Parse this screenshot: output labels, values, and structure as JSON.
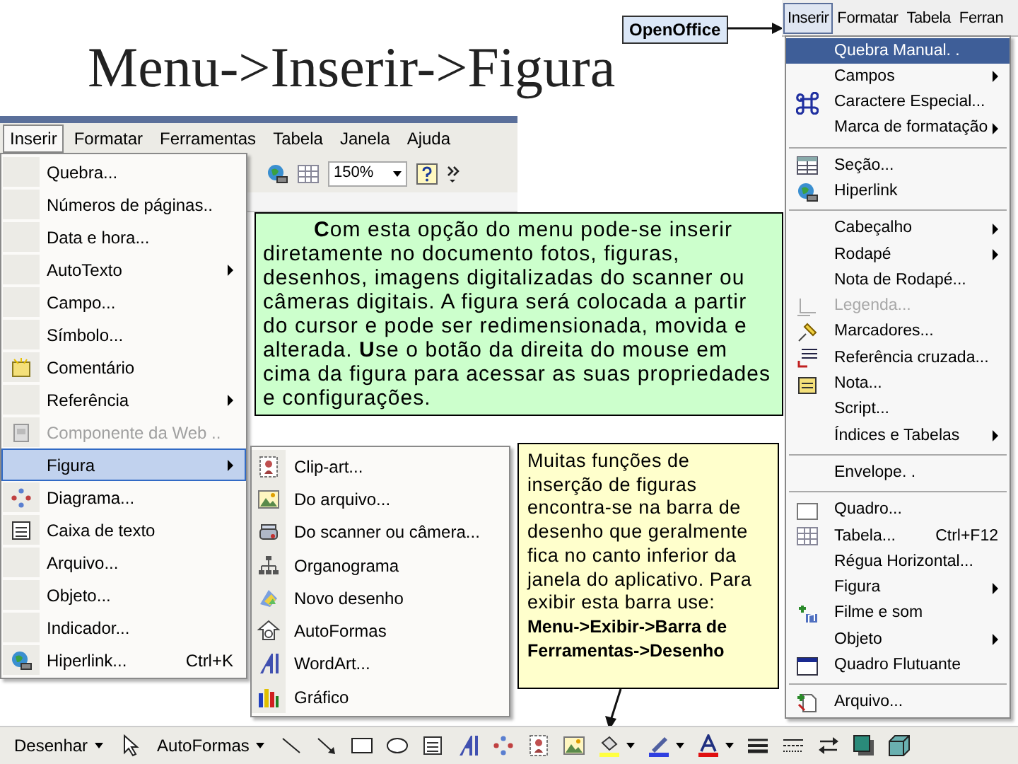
{
  "slide_title": "Menu->Inserir->Figura",
  "callout_label": "OpenOffice",
  "word_window": {
    "menu_bar": [
      {
        "label": "Inserir",
        "selected": true
      },
      {
        "label": "Formatar",
        "selected": false
      },
      {
        "label": "Ferramentas",
        "selected": false
      },
      {
        "label": "Tabela",
        "selected": false
      },
      {
        "label": "Janela",
        "selected": false
      },
      {
        "label": "Ajuda",
        "selected": false
      }
    ],
    "toolbar": {
      "zoom": "150%"
    },
    "insert_menu": {
      "items": [
        {
          "label": "Quebra...",
          "submenu": false,
          "disabled": false,
          "selected": false
        },
        {
          "label": "Números de páginas..",
          "submenu": false,
          "disabled": false,
          "selected": false
        },
        {
          "label": "Data e hora...",
          "submenu": false,
          "disabled": false,
          "selected": false
        },
        {
          "label": "AutoTexto",
          "submenu": true,
          "disabled": false,
          "selected": false
        },
        {
          "label": "Campo...",
          "submenu": false,
          "disabled": false,
          "selected": false
        },
        {
          "label": "Símbolo...",
          "submenu": false,
          "disabled": false,
          "selected": false
        },
        {
          "label": "Comentário",
          "submenu": false,
          "disabled": false,
          "selected": false
        },
        {
          "label": "Referência",
          "submenu": true,
          "disabled": false,
          "selected": false
        },
        {
          "label": "Componente da Web ..",
          "submenu": false,
          "disabled": true,
          "selected": false
        },
        {
          "label": "Figura",
          "submenu": true,
          "disabled": false,
          "selected": true
        },
        {
          "label": "Diagrama...",
          "submenu": false,
          "disabled": false,
          "selected": false
        },
        {
          "label": "Caixa de texto",
          "submenu": false,
          "disabled": false,
          "selected": false
        },
        {
          "label": "Arquivo...",
          "submenu": false,
          "disabled": false,
          "selected": false
        },
        {
          "label": "Objeto...",
          "submenu": false,
          "disabled": false,
          "selected": false
        },
        {
          "label": "Indicador...",
          "submenu": false,
          "disabled": false,
          "selected": false
        },
        {
          "label": "Hiperlink...",
          "shortcut": "Ctrl+K",
          "submenu": false,
          "disabled": false,
          "selected": false
        }
      ]
    },
    "figure_submenu": {
      "items": [
        {
          "label": "Clip-art..."
        },
        {
          "label": "Do arquivo..."
        },
        {
          "label": "Do scanner ou câmera..."
        },
        {
          "label": "Organograma"
        },
        {
          "label": "Novo desenho"
        },
        {
          "label": "AutoFormas"
        },
        {
          "label": "WordArt..."
        },
        {
          "label": "Gráfico"
        }
      ]
    }
  },
  "green_note": "**C**om esta opção do menu pode-se inserir diretamente no documento fotos, figuras, desenhos, imagens digitalizadas do scanner ou câmeras digitais. A figura será colocada a partir do cursor e pode ser redimensionada, movida e alterada. **U**se o botão da direita do mouse em cima da figura para acessar as suas propriedades e configurações.",
  "yellow_note": "Muitas funções de inserção de figuras encontra-se na barra de desenho que geralmente fica no canto inferior da janela do aplicativo. Para exibir esta barra use: **Menu->Exibir->Barra de Ferramentas->Desenho**",
  "openoffice_window": {
    "menu_bar": [
      {
        "label": "Inserir",
        "selected": true
      },
      {
        "label": "Formatar",
        "selected": false
      },
      {
        "label": "Tabela",
        "selected": false
      },
      {
        "label": "Ferran",
        "selected": false
      }
    ],
    "insert_menu": {
      "items": [
        {
          "kind": "item",
          "label": "Quebra Manual. .",
          "submenu": false,
          "disabled": false,
          "selected": true
        },
        {
          "kind": "item",
          "label": "Campos",
          "submenu": true,
          "disabled": false,
          "selected": false
        },
        {
          "kind": "item",
          "label": "Caractere Especial...",
          "submenu": false,
          "disabled": false,
          "selected": false
        },
        {
          "kind": "item",
          "label": "Marca de formatação",
          "submenu": true,
          "disabled": false,
          "selected": false
        },
        {
          "kind": "separator"
        },
        {
          "kind": "item",
          "label": "Seção...",
          "submenu": false,
          "disabled": false,
          "selected": false
        },
        {
          "kind": "item",
          "label": "Hiperlink",
          "submenu": false,
          "disabled": false,
          "selected": false
        },
        {
          "kind": "separator"
        },
        {
          "kind": "item",
          "label": "Cabeçalho",
          "submenu": true,
          "disabled": false,
          "selected": false
        },
        {
          "kind": "item",
          "label": "Rodapé",
          "submenu": true,
          "disabled": false,
          "selected": false
        },
        {
          "kind": "item",
          "label": "Nota de Rodapé...",
          "submenu": false,
          "disabled": false,
          "selected": false
        },
        {
          "kind": "item",
          "label": "Legenda...",
          "submenu": false,
          "disabled": true,
          "selected": false
        },
        {
          "kind": "item",
          "label": "Marcadores...",
          "submenu": false,
          "disabled": false,
          "selected": false
        },
        {
          "kind": "item",
          "label": "Referência cruzada...",
          "submenu": false,
          "disabled": false,
          "selected": false
        },
        {
          "kind": "item",
          "label": "Nota...",
          "submenu": false,
          "disabled": false,
          "selected": false
        },
        {
          "kind": "item",
          "label": "Script...",
          "submenu": false,
          "disabled": false,
          "selected": false
        },
        {
          "kind": "item",
          "label": "Índices e Tabelas",
          "submenu": true,
          "disabled": false,
          "selected": false
        },
        {
          "kind": "separator"
        },
        {
          "kind": "item",
          "label": "Envelope. .",
          "submenu": false,
          "disabled": false,
          "selected": false
        },
        {
          "kind": "separator"
        },
        {
          "kind": "item",
          "label": "Quadro...",
          "submenu": false,
          "disabled": false,
          "selected": false
        },
        {
          "kind": "item",
          "label": "Tabela...",
          "shortcut": "Ctrl+F12",
          "submenu": false,
          "disabled": false,
          "selected": false
        },
        {
          "kind": "item",
          "label": "Régua Horizontal...",
          "submenu": false,
          "disabled": false,
          "selected": false
        },
        {
          "kind": "item",
          "label": "Figura",
          "submenu": true,
          "disabled": false,
          "selected": false
        },
        {
          "kind": "item",
          "label": "Filme e som",
          "submenu": false,
          "disabled": false,
          "selected": false
        },
        {
          "kind": "item",
          "label": "Objeto",
          "submenu": true,
          "disabled": false,
          "selected": false
        },
        {
          "kind": "item",
          "label": "Quadro Flutuante",
          "submenu": false,
          "disabled": false,
          "selected": false
        },
        {
          "kind": "separator"
        },
        {
          "kind": "item",
          "label": "Arquivo...",
          "submenu": false,
          "disabled": false,
          "selected": false
        }
      ]
    }
  },
  "drawing_toolbar": {
    "menus": [
      "Desenhar",
      "AutoFormas"
    ]
  }
}
